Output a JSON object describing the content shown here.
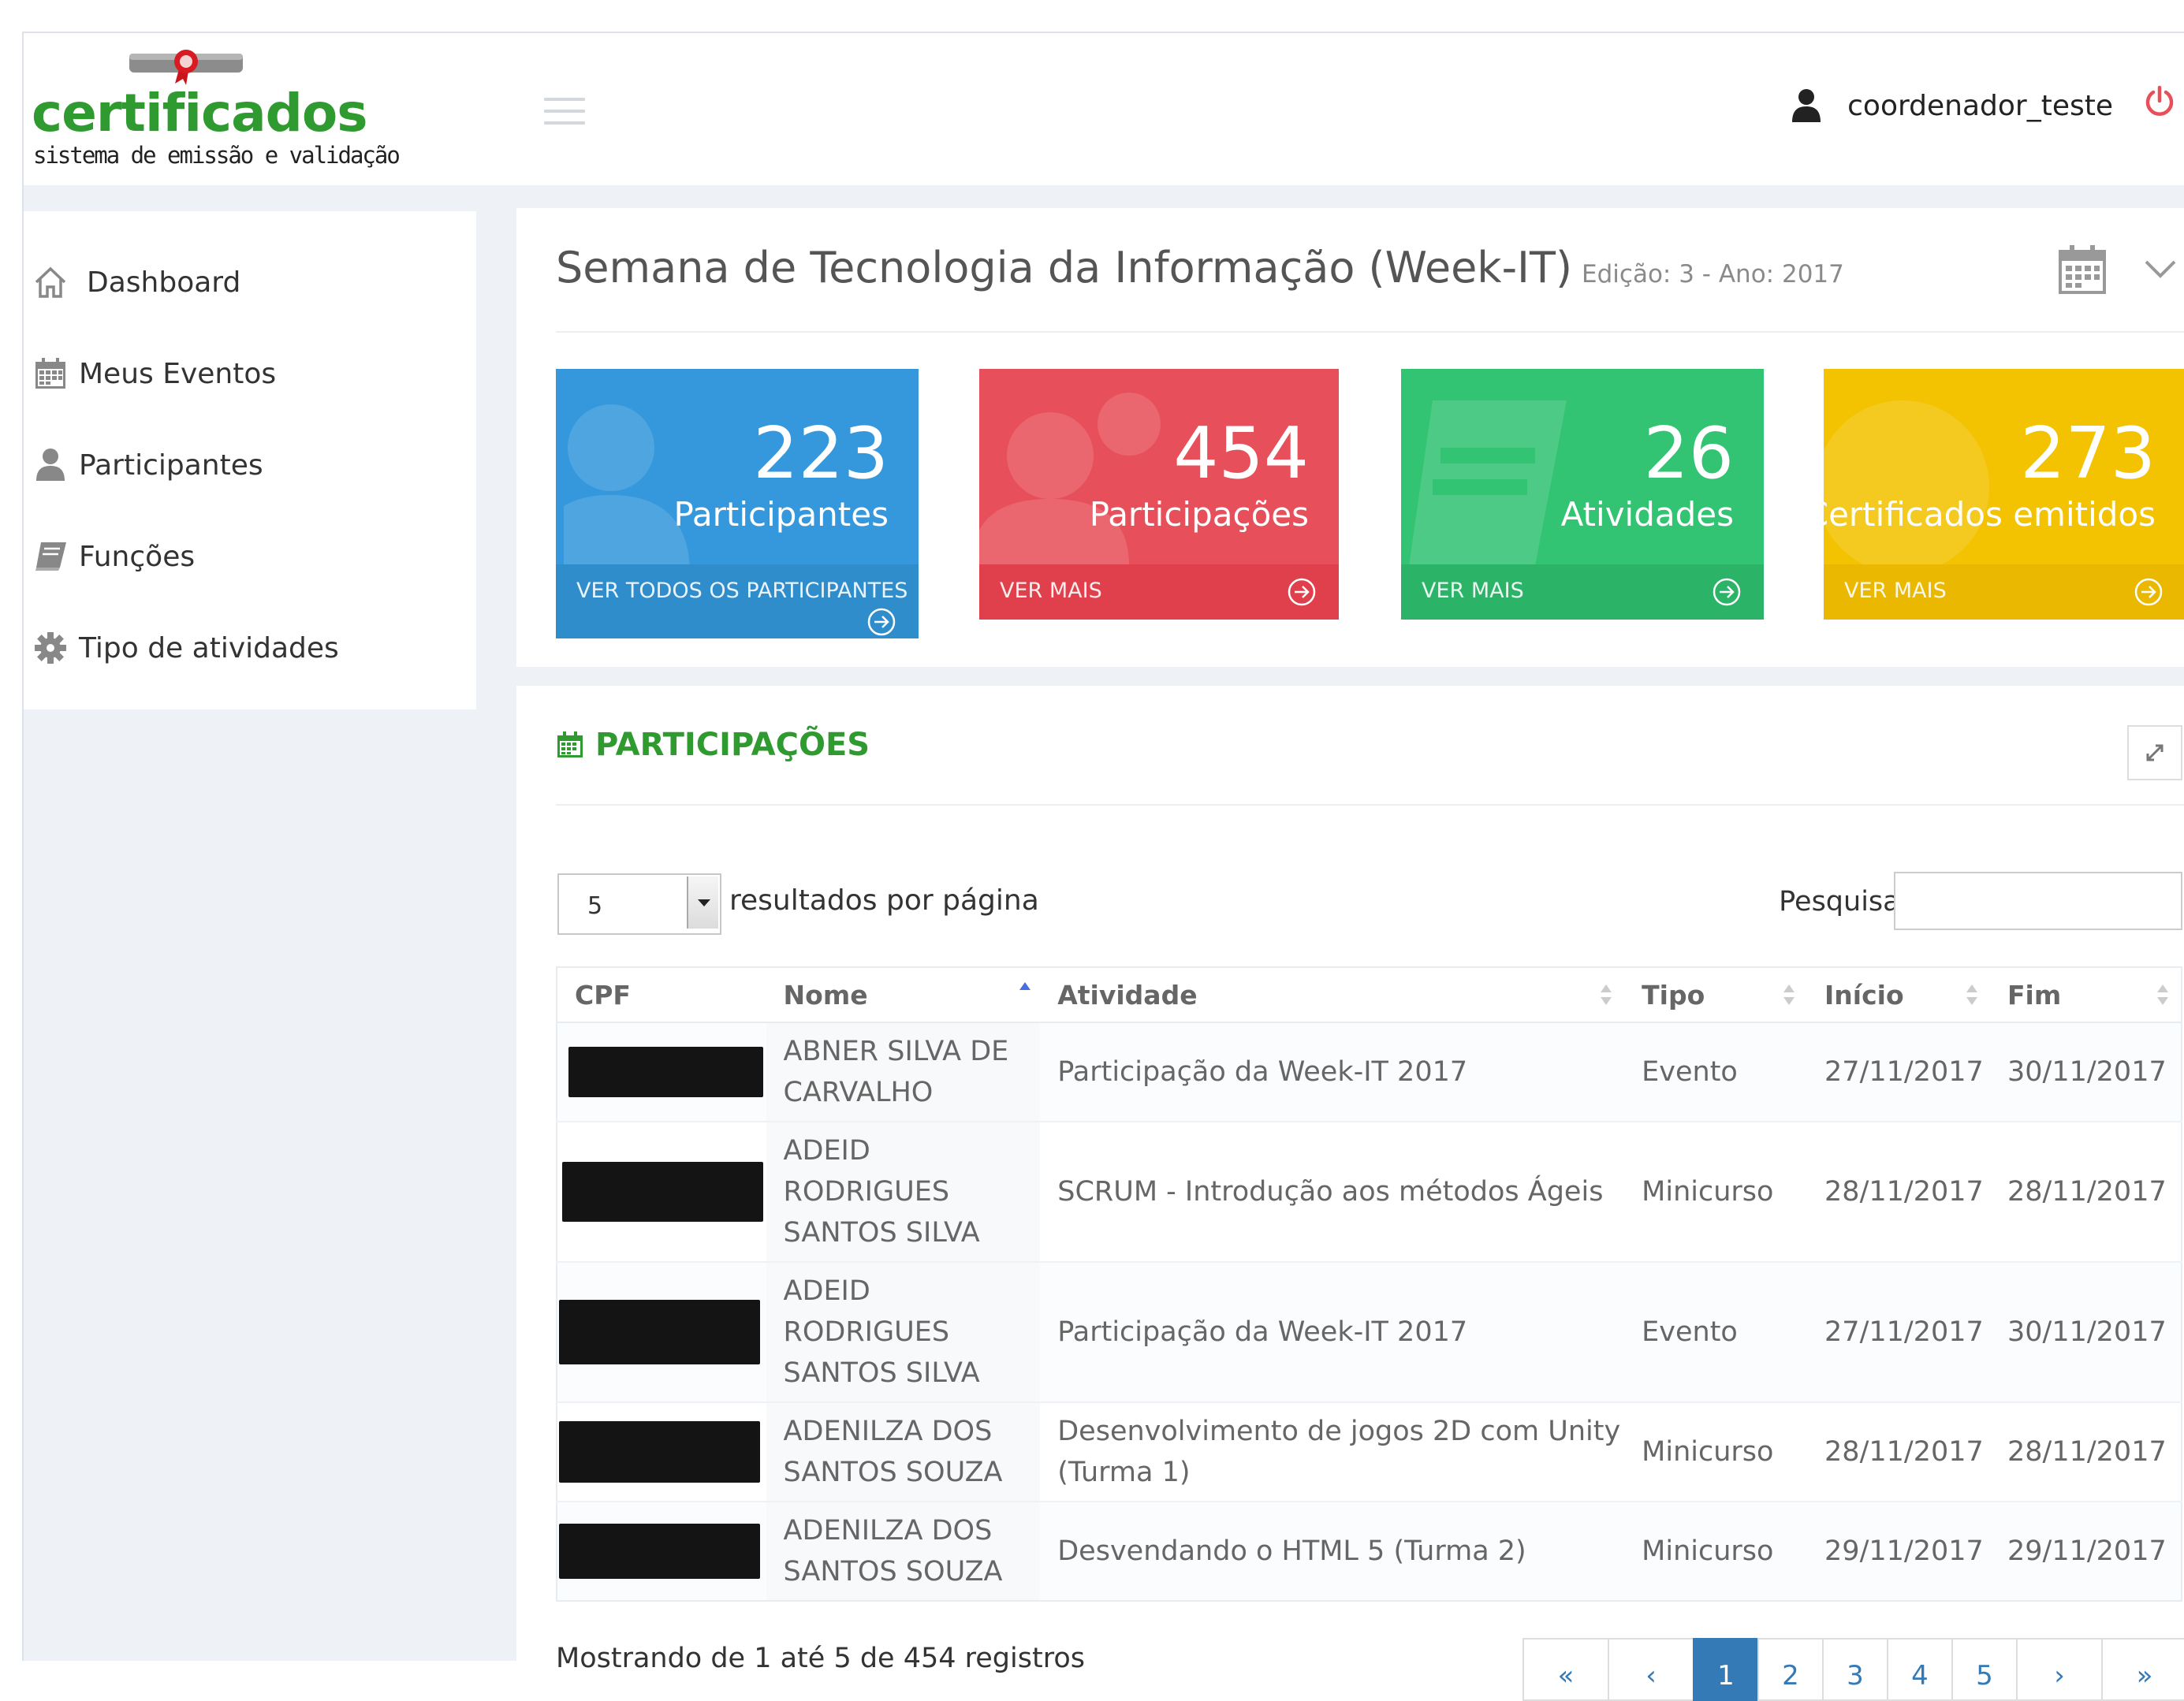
{
  "brand": {
    "name": "certificados",
    "tagline": "sistema de emissão e validação"
  },
  "header": {
    "username": "coordenador_teste"
  },
  "sidebar": {
    "items": [
      {
        "label": "Dashboard",
        "icon": "home-icon"
      },
      {
        "label": "Meus Eventos",
        "icon": "calendar-icon"
      },
      {
        "label": "Participantes",
        "icon": "user-icon"
      },
      {
        "label": "Funções",
        "icon": "book-icon"
      },
      {
        "label": "Tipo de atividades",
        "icon": "gear-icon"
      }
    ]
  },
  "event": {
    "title": "Semana de Tecnologia da Informação (Week-IT)",
    "subtitle": "Edição: 3 - Ano: 2017"
  },
  "stats": [
    {
      "value": "223",
      "label": "Participantes",
      "link": "VER TODOS OS PARTICIPANTES",
      "color": "#3598dc"
    },
    {
      "value": "454",
      "label": "Participações",
      "link": "VER MAIS",
      "color": "#e7505a"
    },
    {
      "value": "26",
      "label": "Atividades",
      "link": "VER MAIS",
      "color": "#32c373"
    },
    {
      "value": "273",
      "label": "Certificados emitidos",
      "link": "VER MAIS",
      "color": "#f3c200"
    }
  ],
  "table_panel": {
    "title": "PARTICIPAÇÕES",
    "page_length": "5",
    "page_length_label": "resultados por página",
    "search_label": "Pesquisar",
    "search_value": "",
    "columns": [
      "CPF",
      "Nome",
      "Atividade",
      "Tipo",
      "Início",
      "Fim"
    ],
    "rows": [
      {
        "nome": "ABNER SILVA DE CARVALHO",
        "atividade": "Participação da Week-IT 2017",
        "tipo": "Evento",
        "inicio": "27/11/2017",
        "fim": "30/11/2017"
      },
      {
        "nome": "ADEID RODRIGUES SANTOS SILVA",
        "atividade": "SCRUM - Introdução aos métodos Ágeis",
        "tipo": "Minicurso",
        "inicio": "28/11/2017",
        "fim": "28/11/2017"
      },
      {
        "nome": "ADEID RODRIGUES SANTOS SILVA",
        "atividade": "Participação da Week-IT 2017",
        "tipo": "Evento",
        "inicio": "27/11/2017",
        "fim": "30/11/2017"
      },
      {
        "nome": "ADENILZA DOS SANTOS SOUZA",
        "atividade": "Desenvolvimento de jogos 2D com Unity (Turma 1)",
        "tipo": "Minicurso",
        "inicio": "28/11/2017",
        "fim": "28/11/2017"
      },
      {
        "nome": "ADENILZA DOS SANTOS SOUZA",
        "atividade": "Desvendando o HTML 5 (Turma 2)",
        "tipo": "Minicurso",
        "inicio": "29/11/2017",
        "fim": "29/11/2017"
      }
    ],
    "info": "Mostrando de 1 até 5 de 454 registros",
    "pagination": [
      "«",
      "‹",
      "1",
      "2",
      "3",
      "4",
      "5",
      "›",
      "»"
    ],
    "current_page": "1"
  },
  "colors": {
    "brand_green": "#2e9a2f",
    "link_blue": "#337ab7",
    "power_red": "#e7505a"
  }
}
